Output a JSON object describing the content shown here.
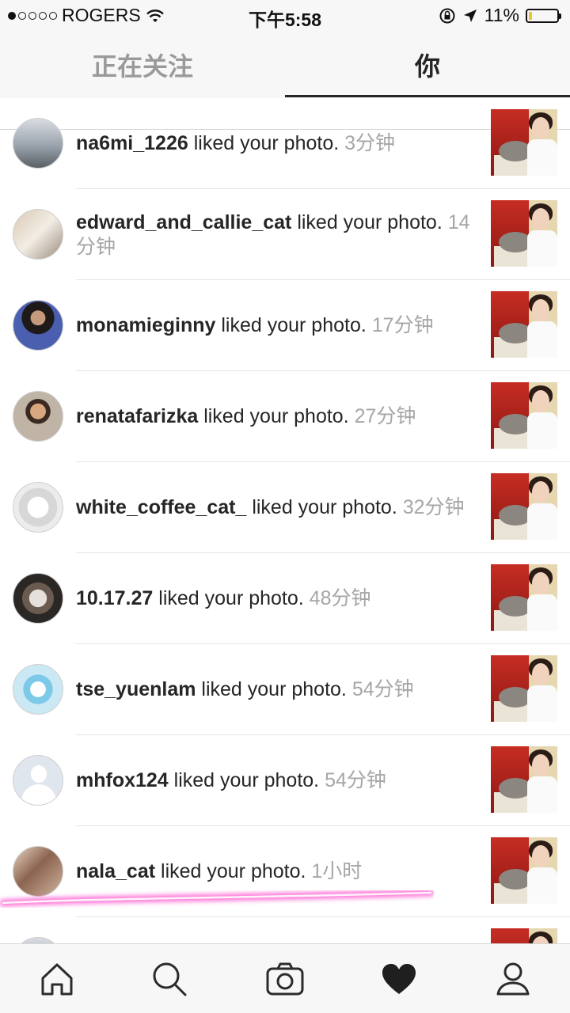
{
  "status_bar": {
    "carrier": "ROGERS",
    "time": "下午5:58",
    "battery": "11%",
    "signal_dots_filled": 1,
    "signal_dots_total": 5
  },
  "tabs": {
    "following": "正在关注",
    "you": "你",
    "active": "you"
  },
  "notifications": [
    {
      "user": "na6mi_1226",
      "action": " liked your photo. ",
      "time": "3分钟"
    },
    {
      "user": "edward_and_callie_cat",
      "action": " liked your photo. ",
      "time": "14分钟"
    },
    {
      "user": "monamieginny",
      "action": " liked your photo. ",
      "time": "17分钟"
    },
    {
      "user": "renatafarizka",
      "action": " liked your photo. ",
      "time": "27分钟"
    },
    {
      "user": "white_coffee_cat_",
      "action": " liked your photo. ",
      "time": "32分钟"
    },
    {
      "user": "10.17.27",
      "action": " liked your photo. ",
      "time": "48分钟"
    },
    {
      "user": "tse_yuenlam",
      "action": " liked your photo. ",
      "time": "54分钟"
    },
    {
      "user": "mhfox124",
      "action": " liked your photo. ",
      "time": "54分钟"
    },
    {
      "user": "nala_cat",
      "action": " liked your photo. ",
      "time": "1小时"
    }
  ],
  "bottom_nav": {
    "items": [
      "home-icon",
      "search-icon",
      "camera-icon",
      "heart-icon",
      "profile-icon"
    ],
    "active": "heart-icon"
  },
  "colors": {
    "highlight": "#ff5fd2",
    "time_text": "#a6a6a6",
    "battery_fill": "#e8c53a"
  }
}
